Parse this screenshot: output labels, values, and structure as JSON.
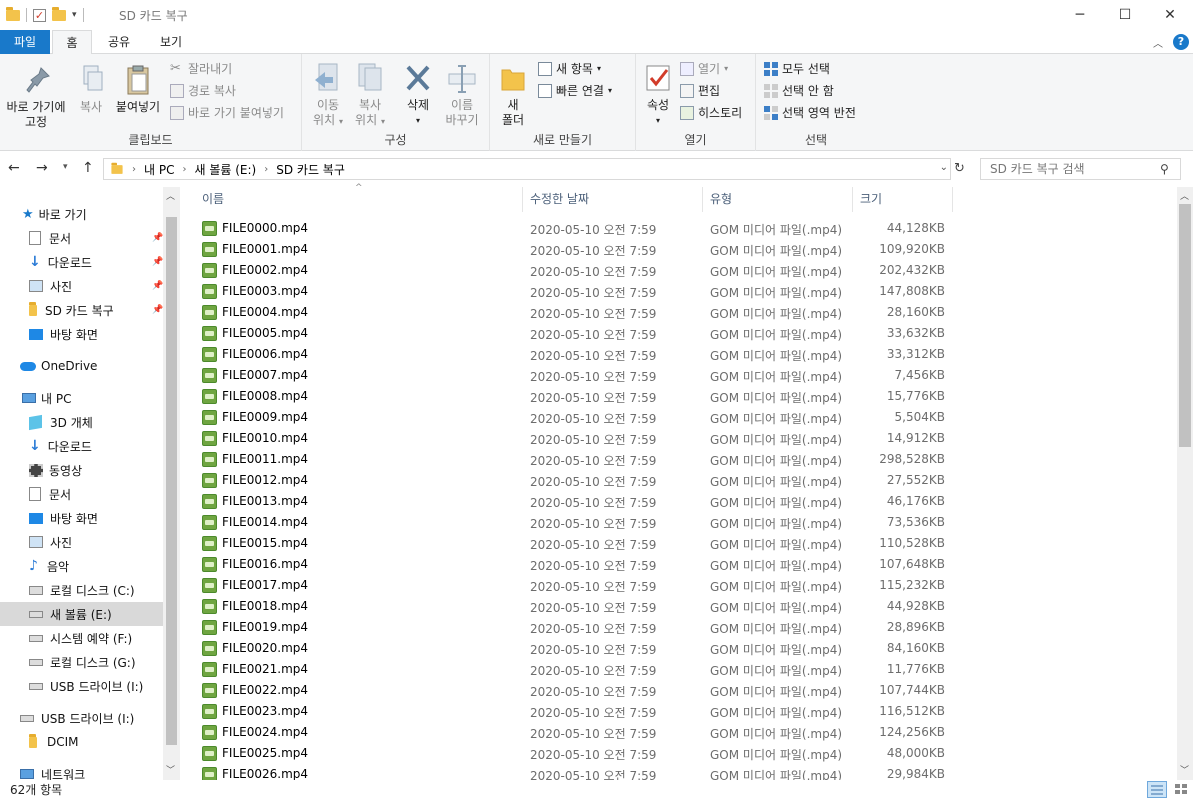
{
  "window": {
    "title": "SD 카드 복구",
    "controls": {
      "minimize": "─",
      "maximize": "☐",
      "close": "✕"
    }
  },
  "tabs": {
    "file": "파일",
    "home": "홈",
    "share": "공유",
    "view": "보기"
  },
  "ribbon": {
    "clipboard": {
      "label": "클립보드",
      "pin_line1": "바로 가기에",
      "pin_line2": "고정",
      "copy": "복사",
      "paste": "붙여넣기",
      "cut": "잘라내기",
      "copy_path": "경로 복사",
      "paste_shortcut": "바로 가기 붙여넣기"
    },
    "organize": {
      "label": "구성",
      "move_line1": "이동",
      "move_line2": "위치",
      "copyto_line1": "복사",
      "copyto_line2": "위치",
      "delete": "삭제",
      "rename_line1": "이름",
      "rename_line2": "바꾸기"
    },
    "new": {
      "label": "새로 만들기",
      "folder_line1": "새",
      "folder_line2": "폴더",
      "new_item": "새 항목",
      "easy_access": "빠른 연결"
    },
    "open": {
      "label": "열기",
      "properties": "속성",
      "open": "열기",
      "edit": "편집",
      "history": "히스토리"
    },
    "select": {
      "label": "선택",
      "select_all": "모두 선택",
      "select_none": "선택 안 함",
      "invert": "선택 영역 반전"
    }
  },
  "address": {
    "segments": [
      "내 PC",
      "새 볼륨 (E:)",
      "SD 카드 복구"
    ],
    "search_placeholder": "SD 카드 복구 검색"
  },
  "nav": {
    "quick_access": "바로 가기",
    "qa_items": [
      "문서",
      "다운로드",
      "사진",
      "SD 카드 복구",
      "바탕 화면"
    ],
    "onedrive": "OneDrive",
    "this_pc": "내 PC",
    "pc_items": [
      "3D 개체",
      "다운로드",
      "동영상",
      "문서",
      "바탕 화면",
      "사진",
      "음악",
      "로컬 디스크 (C:)",
      "새 볼륨 (E:)",
      "시스템 예약 (F:)",
      "로컬 디스크 (G:)",
      "USB 드라이브 (I:)"
    ],
    "usb": "USB 드라이브 (I:)",
    "usb_items": [
      "DCIM"
    ],
    "network": "네트워크"
  },
  "columns": {
    "name": "이름",
    "date": "수정한 날짜",
    "type": "유형",
    "size": "크기"
  },
  "files": [
    {
      "name": "FILE0000.mp4",
      "date": "2020-05-10 오전 7:59",
      "type": "GOM 미디어 파일(.mp4)",
      "size": "44,128KB"
    },
    {
      "name": "FILE0001.mp4",
      "date": "2020-05-10 오전 7:59",
      "type": "GOM 미디어 파일(.mp4)",
      "size": "109,920KB"
    },
    {
      "name": "FILE0002.mp4",
      "date": "2020-05-10 오전 7:59",
      "type": "GOM 미디어 파일(.mp4)",
      "size": "202,432KB"
    },
    {
      "name": "FILE0003.mp4",
      "date": "2020-05-10 오전 7:59",
      "type": "GOM 미디어 파일(.mp4)",
      "size": "147,808KB"
    },
    {
      "name": "FILE0004.mp4",
      "date": "2020-05-10 오전 7:59",
      "type": "GOM 미디어 파일(.mp4)",
      "size": "28,160KB"
    },
    {
      "name": "FILE0005.mp4",
      "date": "2020-05-10 오전 7:59",
      "type": "GOM 미디어 파일(.mp4)",
      "size": "33,632KB"
    },
    {
      "name": "FILE0006.mp4",
      "date": "2020-05-10 오전 7:59",
      "type": "GOM 미디어 파일(.mp4)",
      "size": "33,312KB"
    },
    {
      "name": "FILE0007.mp4",
      "date": "2020-05-10 오전 7:59",
      "type": "GOM 미디어 파일(.mp4)",
      "size": "7,456KB"
    },
    {
      "name": "FILE0008.mp4",
      "date": "2020-05-10 오전 7:59",
      "type": "GOM 미디어 파일(.mp4)",
      "size": "15,776KB"
    },
    {
      "name": "FILE0009.mp4",
      "date": "2020-05-10 오전 7:59",
      "type": "GOM 미디어 파일(.mp4)",
      "size": "5,504KB"
    },
    {
      "name": "FILE0010.mp4",
      "date": "2020-05-10 오전 7:59",
      "type": "GOM 미디어 파일(.mp4)",
      "size": "14,912KB"
    },
    {
      "name": "FILE0011.mp4",
      "date": "2020-05-10 오전 7:59",
      "type": "GOM 미디어 파일(.mp4)",
      "size": "298,528KB"
    },
    {
      "name": "FILE0012.mp4",
      "date": "2020-05-10 오전 7:59",
      "type": "GOM 미디어 파일(.mp4)",
      "size": "27,552KB"
    },
    {
      "name": "FILE0013.mp4",
      "date": "2020-05-10 오전 7:59",
      "type": "GOM 미디어 파일(.mp4)",
      "size": "46,176KB"
    },
    {
      "name": "FILE0014.mp4",
      "date": "2020-05-10 오전 7:59",
      "type": "GOM 미디어 파일(.mp4)",
      "size": "73,536KB"
    },
    {
      "name": "FILE0015.mp4",
      "date": "2020-05-10 오전 7:59",
      "type": "GOM 미디어 파일(.mp4)",
      "size": "110,528KB"
    },
    {
      "name": "FILE0016.mp4",
      "date": "2020-05-10 오전 7:59",
      "type": "GOM 미디어 파일(.mp4)",
      "size": "107,648KB"
    },
    {
      "name": "FILE0017.mp4",
      "date": "2020-05-10 오전 7:59",
      "type": "GOM 미디어 파일(.mp4)",
      "size": "115,232KB"
    },
    {
      "name": "FILE0018.mp4",
      "date": "2020-05-10 오전 7:59",
      "type": "GOM 미디어 파일(.mp4)",
      "size": "44,928KB"
    },
    {
      "name": "FILE0019.mp4",
      "date": "2020-05-10 오전 7:59",
      "type": "GOM 미디어 파일(.mp4)",
      "size": "28,896KB"
    },
    {
      "name": "FILE0020.mp4",
      "date": "2020-05-10 오전 7:59",
      "type": "GOM 미디어 파일(.mp4)",
      "size": "84,160KB"
    },
    {
      "name": "FILE0021.mp4",
      "date": "2020-05-10 오전 7:59",
      "type": "GOM 미디어 파일(.mp4)",
      "size": "11,776KB"
    },
    {
      "name": "FILE0022.mp4",
      "date": "2020-05-10 오전 7:59",
      "type": "GOM 미디어 파일(.mp4)",
      "size": "107,744KB"
    },
    {
      "name": "FILE0023.mp4",
      "date": "2020-05-10 오전 7:59",
      "type": "GOM 미디어 파일(.mp4)",
      "size": "116,512KB"
    },
    {
      "name": "FILE0024.mp4",
      "date": "2020-05-10 오전 7:59",
      "type": "GOM 미디어 파일(.mp4)",
      "size": "124,256KB"
    },
    {
      "name": "FILE0025.mp4",
      "date": "2020-05-10 오전 7:59",
      "type": "GOM 미디어 파일(.mp4)",
      "size": "48,000KB"
    },
    {
      "name": "FILE0026.mp4",
      "date": "2020-05-10 오전 7:59",
      "type": "GOM 미디어 파일(.mp4)",
      "size": "29,984KB"
    }
  ],
  "status": {
    "count": "62개 항목"
  },
  "colors": {
    "accent": "#1979ca",
    "selection": "#d9d9d9",
    "header_text": "#4c607a"
  }
}
